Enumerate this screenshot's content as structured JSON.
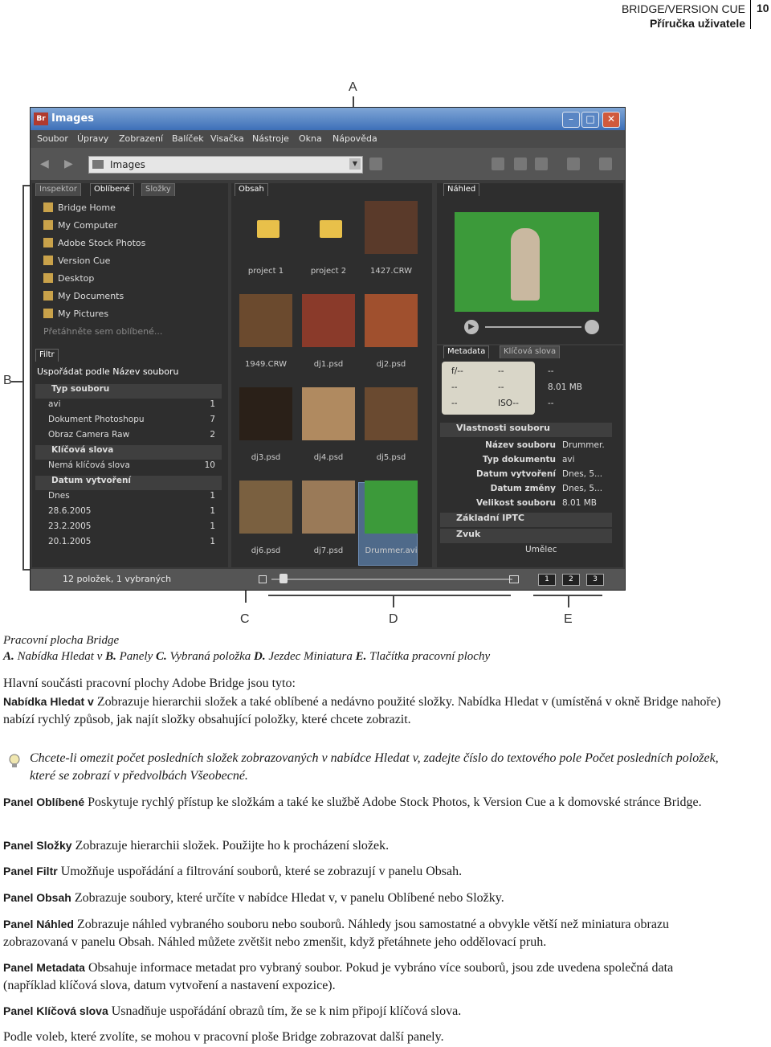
{
  "header": {
    "title": "BRIDGE/VERSION CUE",
    "subtitle": "Příručka uživatele",
    "page": "10"
  },
  "callouts": {
    "a": "A",
    "b": "B",
    "c": "C",
    "d": "D",
    "e": "E"
  },
  "window": {
    "title": "Images",
    "app_icon": "Br",
    "menu": [
      "Soubor",
      "Úpravy",
      "Zobrazení",
      "Balíček",
      "Visačka",
      "Nástroje",
      "Okna",
      "Nápověda"
    ],
    "path": "Images",
    "left_tabs": [
      "Inspektor",
      "Oblíbené",
      "Složky"
    ],
    "favorites": [
      "Bridge Home",
      "My Computer",
      "Adobe Stock Photos",
      "Version Cue",
      "Desktop",
      "My Documents",
      "My Pictures",
      "Přetáhněte sem oblíbené..."
    ],
    "filter_tab": "Filtr",
    "sort_label": "Uspořádat podle Název souboru",
    "filter_rows": [
      {
        "label": "Typ souboru",
        "count": "",
        "head": true
      },
      {
        "label": "avi",
        "count": "1",
        "head": false
      },
      {
        "label": "Dokument Photoshopu",
        "count": "7",
        "head": false
      },
      {
        "label": "Obraz Camera Raw",
        "count": "2",
        "head": false
      },
      {
        "label": "Klíčová slova",
        "count": "",
        "head": true
      },
      {
        "label": "Nemá klíčová slova",
        "count": "10",
        "head": false
      },
      {
        "label": "Datum vytvoření",
        "count": "",
        "head": true
      },
      {
        "label": "Dnes",
        "count": "1",
        "head": false
      },
      {
        "label": "28.6.2005",
        "count": "1",
        "head": false
      },
      {
        "label": "23.2.2005",
        "count": "1",
        "head": false
      },
      {
        "label": "20.1.2005",
        "count": "1",
        "head": false
      }
    ],
    "content_tab": "Obsah",
    "thumbs": [
      "project 1",
      "project 2",
      "1427.CRW",
      "1949.CRW",
      "dj1.psd",
      "dj2.psd",
      "dj3.psd",
      "dj4.psd",
      "dj5.psd",
      "dj6.psd",
      "dj7.psd",
      "Drummer.avi"
    ],
    "preview_tab": "Náhled",
    "meta_tabs": [
      "Metadata",
      "Klíčová slova"
    ],
    "meta_top": [
      "f/--",
      "--",
      "--",
      "--",
      "--",
      "ISO--",
      "--",
      "8.01 MB",
      "--"
    ],
    "file_props_title": "Vlastnosti souboru",
    "file_props": [
      {
        "k": "Název souboru",
        "v": "Drummer."
      },
      {
        "k": "Typ dokumentu",
        "v": "avi"
      },
      {
        "k": "Datum vytvoření",
        "v": "Dnes, 5..."
      },
      {
        "k": "Datum změny",
        "v": "Dnes, 5..."
      },
      {
        "k": "Velikost souboru",
        "v": "8.01 MB"
      }
    ],
    "meta_sections": [
      "Základní IPTC",
      "Zvuk",
      "Umělec"
    ],
    "status": "12 položek, 1 vybraných",
    "ws_buttons": [
      "1",
      "2",
      "3"
    ]
  },
  "caption": {
    "title": "Pracovní plocha Bridge",
    "items": [
      {
        "letter": "A.",
        "text": "Nabídka Hledat v"
      },
      {
        "letter": "B.",
        "text": "Panely"
      },
      {
        "letter": "C.",
        "text": "Vybraná položka"
      },
      {
        "letter": "D.",
        "text": "Jezdec Miniatura"
      },
      {
        "letter": "E.",
        "text": "Tlačítka pracovní plochy"
      }
    ]
  },
  "intro": "Hlavní součásti pracovní plochy Adobe Bridge jsou tyto:",
  "p1": {
    "term": "Nabídka Hledat v",
    "text": "Zobrazuje hierarchii složek a také oblíbené a nedávno použité složky. Nabídka Hledat v (umístěná v okně Bridge nahoře) nabízí rychlý způsob, jak najít složky obsahující položky, které chcete zobrazit."
  },
  "tip": "Chcete-li omezit počet posledních složek zobrazovaných v nabídce Hledat v, zadejte číslo do textového pole Počet posledních položek, které se zobrazí v předvolbách Všeobecné.",
  "p2": {
    "term": "Panel Oblíbené",
    "text": "Poskytuje rychlý přístup ke složkám a také ke službě Adobe Stock Photos, k Version Cue a k domovské stránce Bridge."
  },
  "p3": {
    "term": "Panel Složky",
    "text": "Zobrazuje hierarchii složek. Použijte ho k procházení složek."
  },
  "p4": {
    "term": "Panel Filtr",
    "text": "Umožňuje uspořádání a filtrování souborů, které se zobrazují v panelu Obsah."
  },
  "p5": {
    "term": "Panel Obsah",
    "text": "Zobrazuje soubory, které určíte v nabídce Hledat v, v panelu Oblíbené nebo Složky."
  },
  "p6": {
    "term": "Panel Náhled",
    "text": "Zobrazuje náhled vybraného souboru nebo souborů. Náhledy jsou samostatné a obvykle větší než miniatura obrazu zobrazovaná v panelu Obsah. Náhled můžete zvětšit nebo zmenšit, když přetáhnete jeho oddělovací pruh."
  },
  "p7": {
    "term": "Panel Metadata",
    "text": "Obsahuje informace metadat pro vybraný soubor. Pokud je vybráno více souborů, jsou zde uvedena společná data (například klíčová slova, datum vytvoření a nastavení expozice)."
  },
  "p8": {
    "term": "Panel Klíčová slova",
    "text": "Usnadňuje uspořádání obrazů tím, že se k nim připojí klíčová slova."
  },
  "closing": "Podle voleb, které zvolíte, se mohou v pracovní ploše Bridge zobrazovat další panely."
}
